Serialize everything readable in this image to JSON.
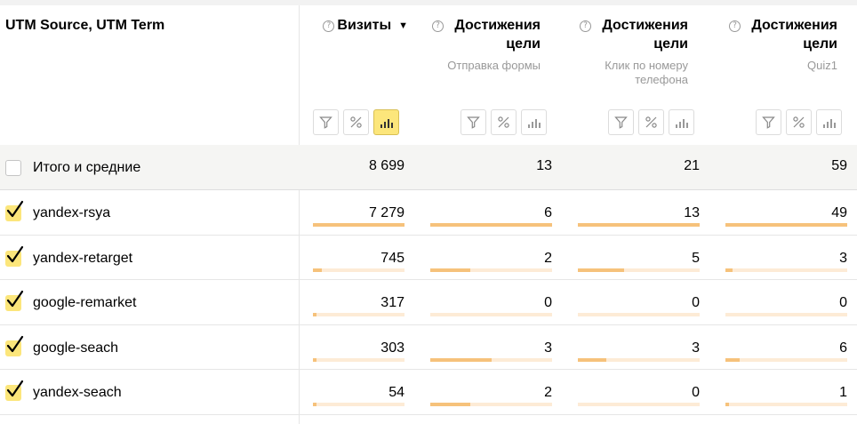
{
  "dimension_header": "UTM Source, UTM Term",
  "columns": [
    {
      "title": "Визиты",
      "subtitle": "",
      "sorted": true,
      "sort_icon": "sort-desc-icon",
      "total": "8 699"
    },
    {
      "title": "Достижения цели",
      "subtitle": "Отправка формы",
      "sorted": false,
      "total": "13"
    },
    {
      "title": "Достижения цели",
      "subtitle": "Клик по номеру телефона",
      "sorted": false,
      "total": "21"
    },
    {
      "title": "Достижения цели",
      "subtitle": "Quiz1",
      "sorted": false,
      "total": "59"
    }
  ],
  "toolbar_buttons": [
    "filter-icon",
    "percent-icon",
    "bar-chart-icon"
  ],
  "total_row": {
    "label": "Итого и средние",
    "checked": false
  },
  "rows": [
    {
      "label": "yandex-rsya",
      "checked": true,
      "values": [
        "7 279",
        "6",
        "13",
        "49"
      ],
      "fractions": [
        1.0,
        1.0,
        1.0,
        1.0
      ]
    },
    {
      "label": "yandex-retarget",
      "checked": true,
      "values": [
        "745",
        "2",
        "5",
        "3"
      ],
      "fractions": [
        0.1,
        0.33,
        0.38,
        0.06
      ]
    },
    {
      "label": "google-remarket",
      "checked": true,
      "values": [
        "317",
        "0",
        "0",
        "0"
      ],
      "fractions": [
        0.04,
        0.0,
        0.0,
        0.0
      ]
    },
    {
      "label": "google-seach",
      "checked": true,
      "values": [
        "303",
        "3",
        "3",
        "6"
      ],
      "fractions": [
        0.04,
        0.5,
        0.23,
        0.12
      ]
    },
    {
      "label": "yandex-seach",
      "checked": true,
      "values": [
        "54",
        "2",
        "0",
        "1"
      ],
      "fractions": [
        0.01,
        0.33,
        0.0,
        0.02
      ]
    }
  ],
  "colors": {
    "accent": "#fce67b",
    "bar_fill": "#f6c27b",
    "bar_track": "#fdebd6",
    "total_bg": "#f5f5f3"
  }
}
